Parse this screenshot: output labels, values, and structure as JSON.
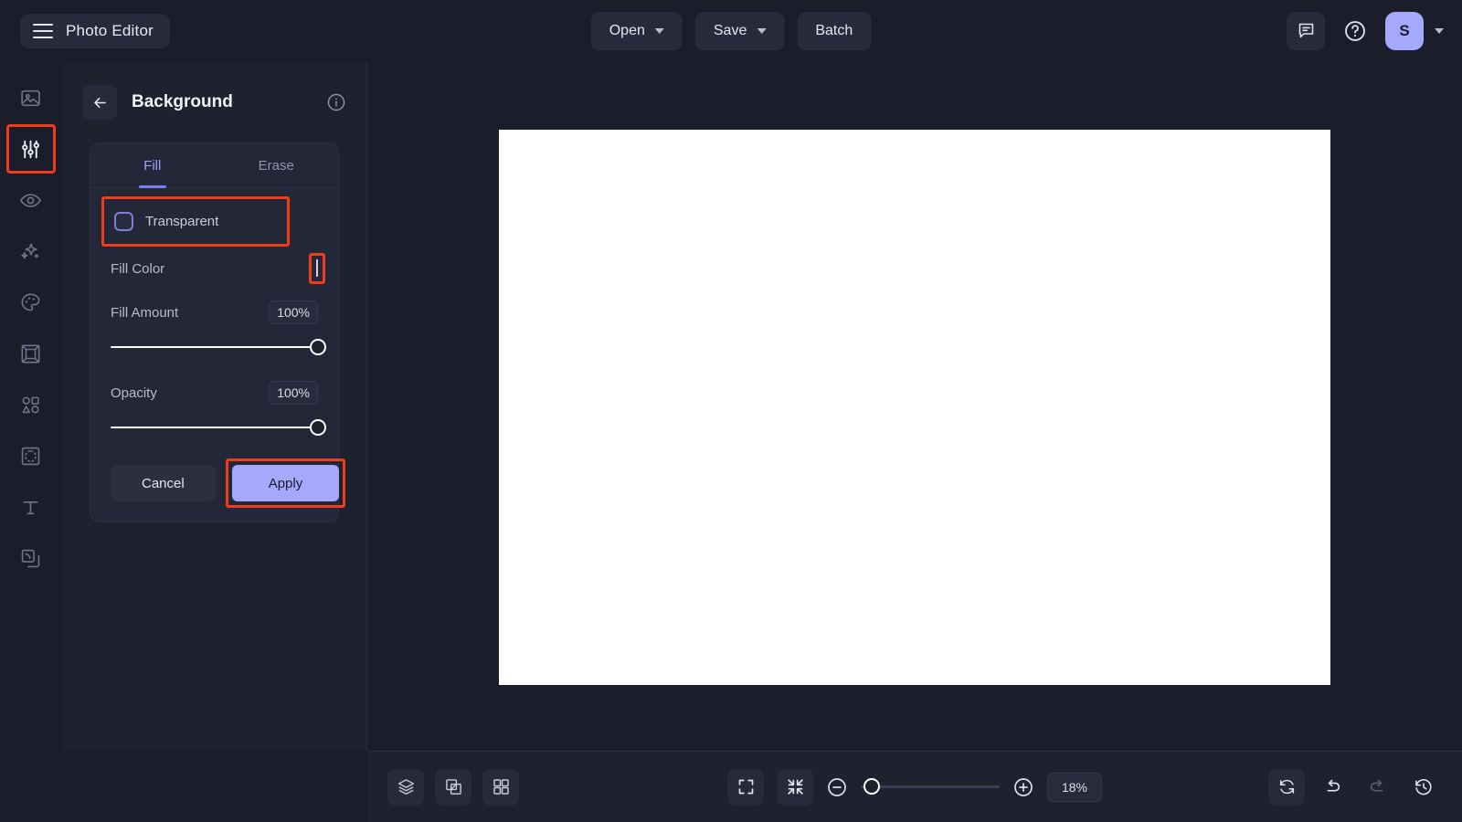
{
  "app": {
    "title": "Photo Editor",
    "accent_color": "#a5a8fb",
    "annotation_color": "#f03c18",
    "panel_bg": "#1e212e",
    "canvas_bg": "#ffffff"
  },
  "topbar": {
    "menu_icon": "hamburger-icon",
    "open_label": "Open",
    "save_label": "Save",
    "batch_label": "Batch",
    "feedback_icon": "comment-icon",
    "help_icon": "help-circle-icon",
    "avatar_initial": "S",
    "account_caret_icon": "chevron-down-icon"
  },
  "rail": {
    "items": [
      {
        "name": "sidebar-item-image",
        "icon": "image-icon",
        "active": false
      },
      {
        "name": "sidebar-item-adjust",
        "icon": "sliders-icon",
        "active": true
      },
      {
        "name": "sidebar-item-retouch",
        "icon": "eye-icon",
        "active": false
      },
      {
        "name": "sidebar-item-effects",
        "icon": "sparkles-icon",
        "active": false
      },
      {
        "name": "sidebar-item-color",
        "icon": "palette-icon",
        "active": false
      },
      {
        "name": "sidebar-item-transform",
        "icon": "frame-icon",
        "active": false
      },
      {
        "name": "sidebar-item-shapes",
        "icon": "shapes-icon",
        "active": false
      },
      {
        "name": "sidebar-item-background",
        "icon": "cutout-icon",
        "active": false
      },
      {
        "name": "sidebar-item-text",
        "icon": "text-icon",
        "active": false
      },
      {
        "name": "sidebar-item-layers",
        "icon": "layers-icon",
        "active": false
      }
    ]
  },
  "panel": {
    "back_icon": "arrow-left-icon",
    "title": "Background",
    "info_icon": "info-icon",
    "tabs": [
      {
        "label": "Fill",
        "active": true
      },
      {
        "label": "Erase",
        "active": false
      }
    ],
    "transparent": {
      "label": "Transparent",
      "checked": false
    },
    "fill_color": {
      "label": "Fill Color",
      "value": "#ffffff"
    },
    "fill_amount": {
      "label": "Fill Amount",
      "value": "100%",
      "percent": 100
    },
    "opacity": {
      "label": "Opacity",
      "value": "100%",
      "percent": 100
    },
    "cancel_label": "Cancel",
    "apply_label": "Apply"
  },
  "bottombar": {
    "layers_icon": "layers-stack-icon",
    "compare_icon": "compare-split-icon",
    "grid_icon": "grid-icon",
    "fit_screen_icon": "fit-screen-icon",
    "fit_contract_icon": "fit-contract-icon",
    "zoom_out_icon": "zoom-out-icon",
    "zoom_in_icon": "zoom-in-icon",
    "zoom_value": "18%",
    "zoom_percent": 8,
    "reset_icon": "reset-icon",
    "undo_icon": "undo-icon",
    "redo_icon": "redo-icon",
    "history_icon": "history-icon"
  }
}
